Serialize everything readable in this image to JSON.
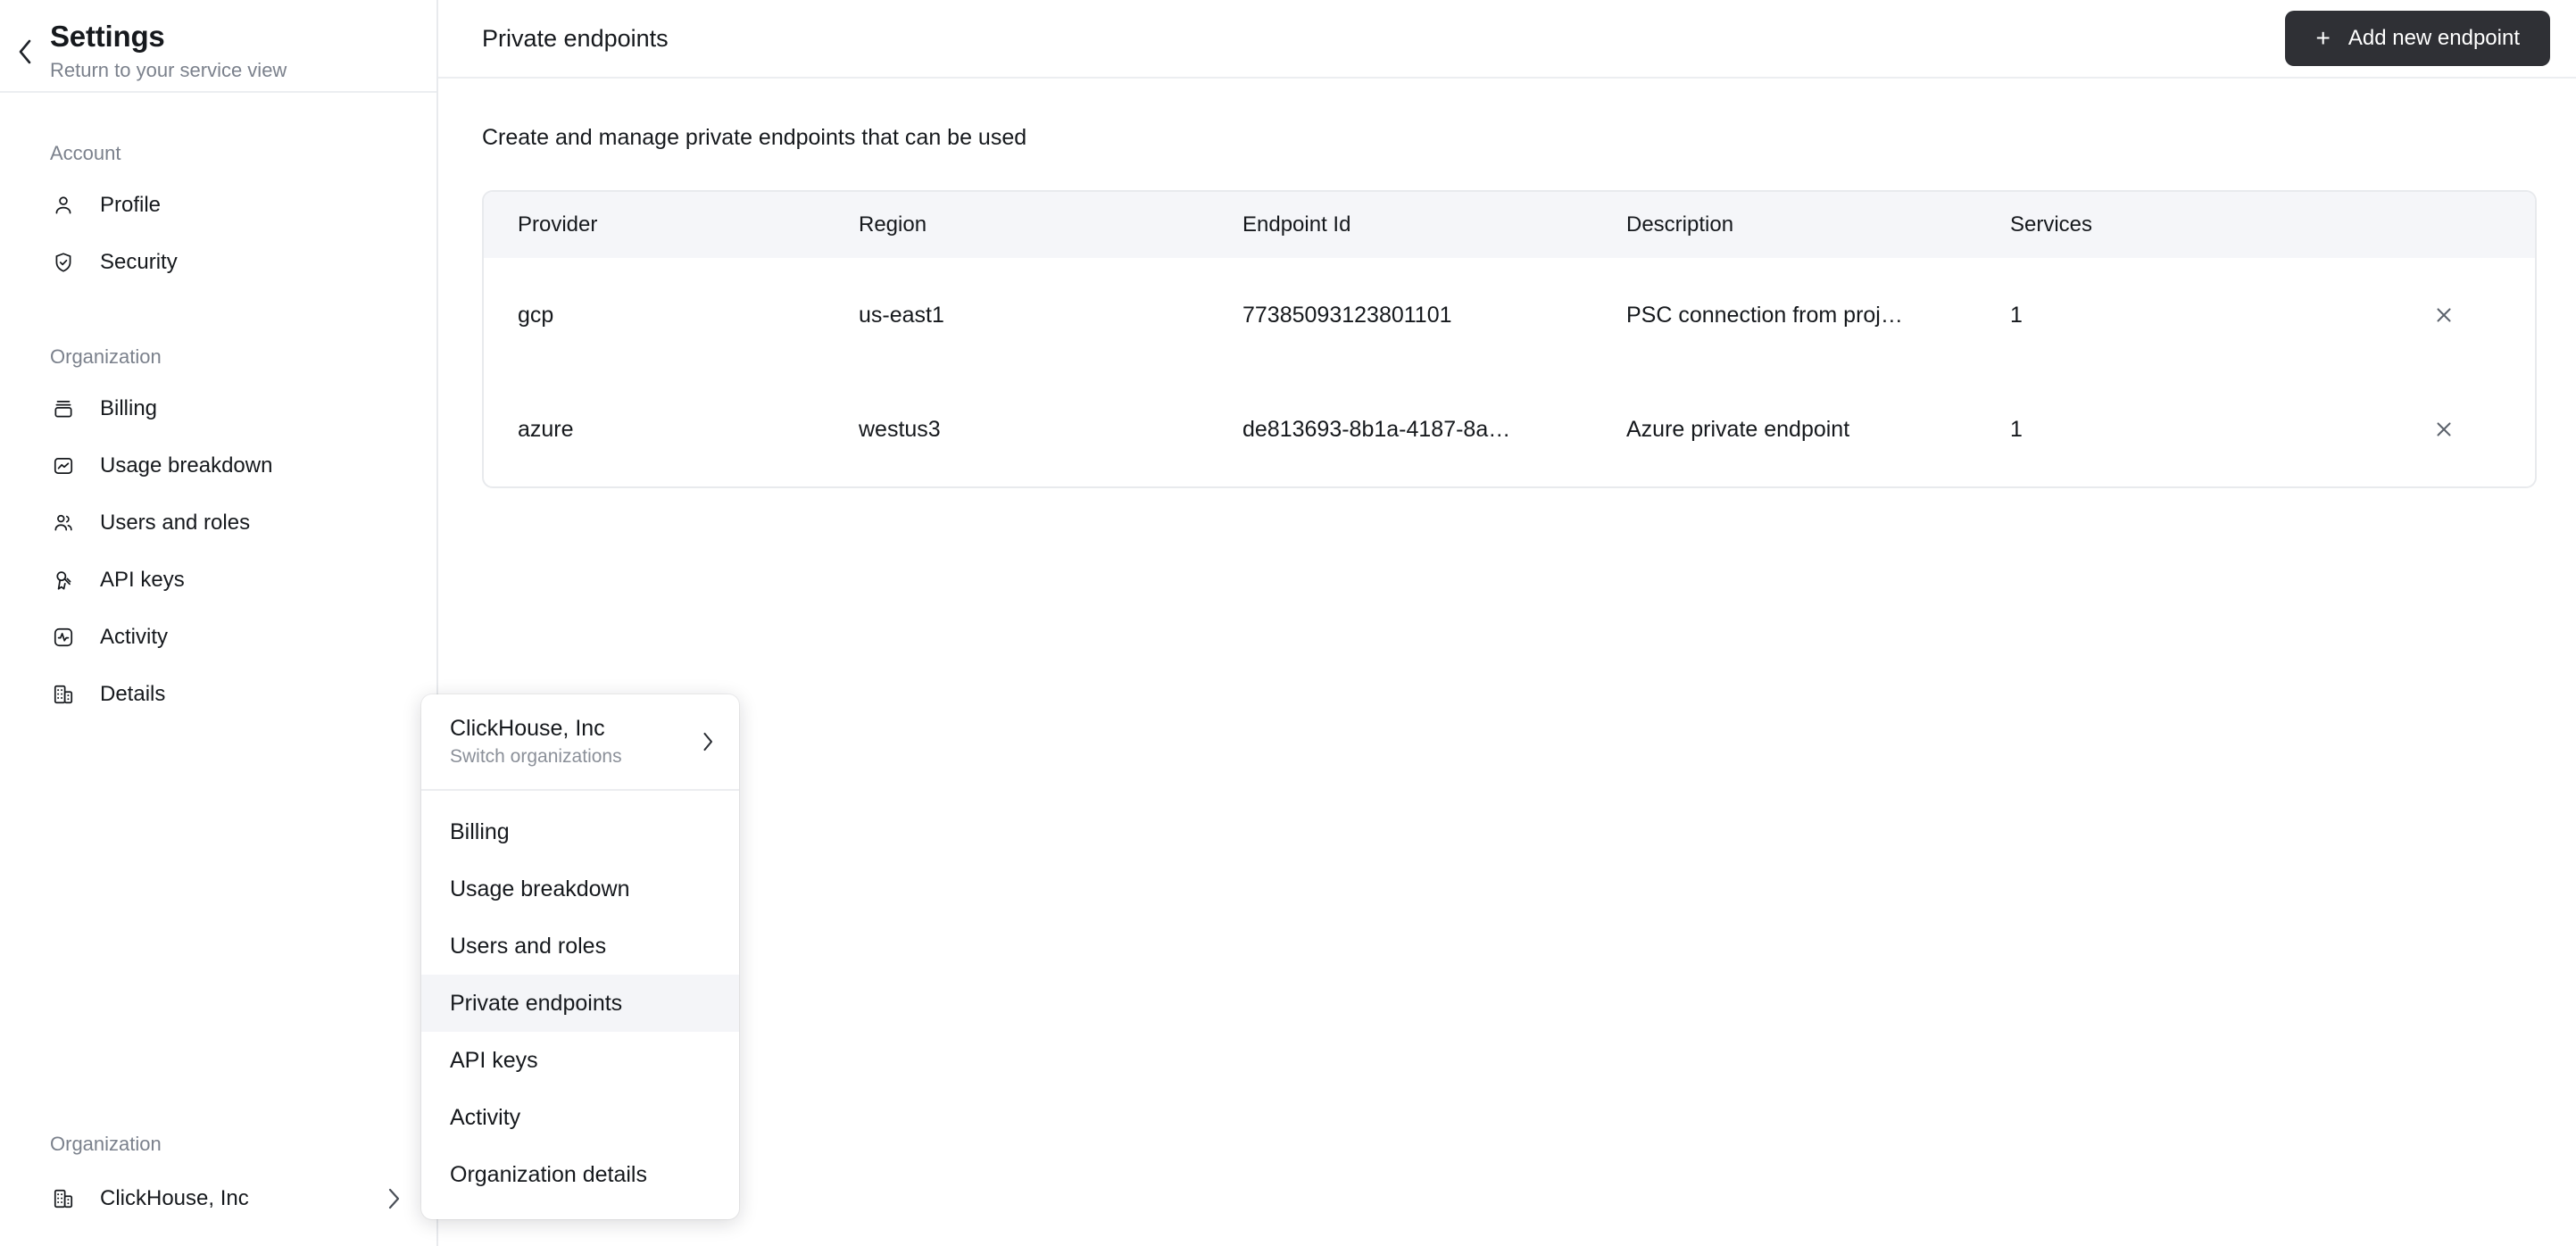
{
  "sidebar": {
    "back_icon": "chevron-left-icon",
    "title": "Settings",
    "subtitle": "Return to your service view",
    "sections": [
      {
        "label": "Account",
        "items": [
          {
            "label": "Profile",
            "icon": "user-icon"
          },
          {
            "label": "Security",
            "icon": "shield-check-icon"
          }
        ]
      },
      {
        "label": "Organization",
        "items": [
          {
            "label": "Billing",
            "icon": "billing-icon"
          },
          {
            "label": "Usage breakdown",
            "icon": "chart-square-icon"
          },
          {
            "label": "Users and roles",
            "icon": "users-icon"
          },
          {
            "label": "API keys",
            "icon": "key-icon"
          },
          {
            "label": "Activity",
            "icon": "activity-square-icon"
          },
          {
            "label": "Details",
            "icon": "building-icon"
          }
        ]
      }
    ],
    "bottom": {
      "label": "Organization",
      "org_name": "ClickHouse, Inc",
      "org_icon": "building-icon",
      "chevron_icon": "chevron-right-icon"
    }
  },
  "header": {
    "title": "Private endpoints",
    "add_button": {
      "label": "Add new endpoint",
      "plus_icon": "+"
    }
  },
  "main": {
    "description": "Create and manage private endpoints that can be used",
    "table": {
      "columns": [
        "Provider",
        "Region",
        "Endpoint Id",
        "Description",
        "Services"
      ],
      "rows": [
        {
          "provider": "gcp",
          "region": "us-east1",
          "endpoint_id": "77385093123801101",
          "description": "PSC connection from proj…",
          "services": "1",
          "delete_icon": "close-icon"
        },
        {
          "provider": "azure",
          "region": "westus3",
          "endpoint_id": "de813693-8b1a-4187-8a…",
          "description": "Azure private endpoint",
          "services": "1",
          "delete_icon": "close-icon"
        }
      ]
    }
  },
  "popup": {
    "org_name": "ClickHouse, Inc",
    "org_sub": "Switch organizations",
    "chevron_icon": "chevron-right-icon",
    "items": [
      {
        "label": "Billing",
        "active": false
      },
      {
        "label": "Usage breakdown",
        "active": false
      },
      {
        "label": "Users and roles",
        "active": false
      },
      {
        "label": "Private endpoints",
        "active": true
      },
      {
        "label": "API keys",
        "active": false
      },
      {
        "label": "Activity",
        "active": false
      },
      {
        "label": "Organization details",
        "active": false
      }
    ]
  },
  "colors": {
    "button_dark": "#2f3035",
    "table_header_bg": "#f5f6f9",
    "muted_text": "#7b818c",
    "border": "#e8eaed",
    "active_item_bg": "#f4f5f8"
  }
}
